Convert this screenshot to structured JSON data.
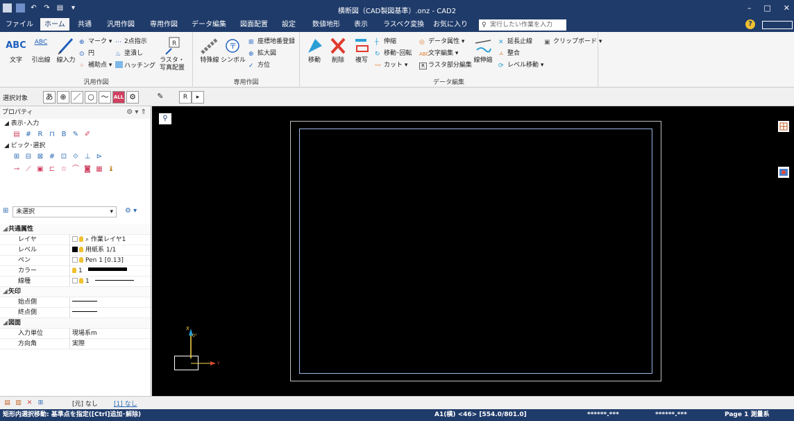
{
  "window": {
    "title": "横断図（CAD製図基準）.onz - CAD2",
    "minimize": "–",
    "maximize": "□",
    "close": "✕"
  },
  "tabs": [
    {
      "label": "ファイル",
      "name": "tab-file"
    },
    {
      "label": "ホーム",
      "name": "tab-home"
    },
    {
      "label": "共通",
      "name": "tab-common"
    },
    {
      "label": "汎用作図",
      "name": "tab-general-drawing"
    },
    {
      "label": "専用作図",
      "name": "tab-special-drawing"
    },
    {
      "label": "データ編集",
      "name": "tab-data-edit"
    },
    {
      "label": "図面配置",
      "name": "tab-drawing-layout"
    },
    {
      "label": "設定",
      "name": "tab-settings"
    },
    {
      "label": "数値地形",
      "name": "tab-numeric-terrain"
    },
    {
      "label": "表示",
      "name": "tab-view"
    },
    {
      "label": "ラスベク変換",
      "name": "tab-raster-vector"
    },
    {
      "label": "お気に入り",
      "name": "tab-favorites"
    }
  ],
  "search": {
    "placeholder": "実行したい作業を入力"
  },
  "help_icon": "?",
  "ribbon": {
    "groups": {
      "general": "汎用作図",
      "special": "専用作図",
      "data_edit": "データ編集"
    },
    "text_btn": "文字",
    "text_icon": "ABC",
    "leader_btn": "引出線",
    "leader_icon": "ABC",
    "line_input_btn": "線入力",
    "mark": "マーク",
    "circle": "円",
    "aux_point": "補助点",
    "two_point": "2点指示",
    "fill": "塗潰し",
    "hatching": "ハッチング",
    "raster_photo_1": "ラスタ・",
    "raster_photo_2": "写真配置",
    "special_line": "特殊線",
    "symbol": "シンボル",
    "coord_register": "座標地番登録",
    "zoom_view": "拡大図",
    "direction": "方位",
    "move": "移動",
    "delete": "削除",
    "copy": "複写",
    "stretch": "伸縮",
    "move_rotate": "移動･回転",
    "cut": "カット",
    "data_attr": "データ属性",
    "text_edit": "文字編集",
    "raster_partial_edit": "ラスタ部分編集",
    "line_stretch": "線伸縮",
    "extend_stop": "延長止線",
    "align": "整合",
    "level_move": "レベル移動",
    "clipboard": "クリップボード"
  },
  "select_toolbar": {
    "label": "選択対象",
    "buttons": [
      "あ",
      "⊕",
      "／",
      "○",
      "〜",
      "ALL",
      "⚙",
      "✎",
      "R",
      "▸"
    ]
  },
  "panel": {
    "title": "プロパティ",
    "sec_display": "表示･入力",
    "sec_pick": "ピック･選択",
    "selection": "未選択",
    "props": [
      {
        "type": "cat",
        "k": "共通属性"
      },
      {
        "k": "レイヤ",
        "v": "作業レイヤ1"
      },
      {
        "k": "レベル",
        "v": "用紙系 1/1"
      },
      {
        "k": "ペン",
        "v": "Pen 1 [0.13]"
      },
      {
        "k": "カラー",
        "v": "1"
      },
      {
        "k": "線種",
        "v": "1"
      },
      {
        "type": "cat",
        "k": "矢印"
      },
      {
        "k": "始点側",
        "v": ""
      },
      {
        "k": "終点側",
        "v": ""
      },
      {
        "type": "cat",
        "k": "図面"
      },
      {
        "k": "入力単位",
        "v": "現場系m"
      },
      {
        "k": "方向角",
        "v": "実際"
      }
    ]
  },
  "bottom_tabs": {
    "tab1": "[元] なし",
    "tab2": "[1] なし"
  },
  "status": {
    "message": "矩形内選択移動: 基準点を指定([Ctrl]追加･解除)",
    "paper": "A1(横) <46> [554.0/801.0]",
    "coord1": "******.***",
    "coord2": "******.***",
    "page": "Page  1  測量系"
  },
  "canvas": {
    "axis_x": "Y",
    "axis_y": "X",
    "axis_origin": "0°",
    "colors": {
      "background": "#000000",
      "frame_outer": "#bfbfbf",
      "frame_inner": "#9fb8e8",
      "axis": "#ffd84a"
    }
  }
}
